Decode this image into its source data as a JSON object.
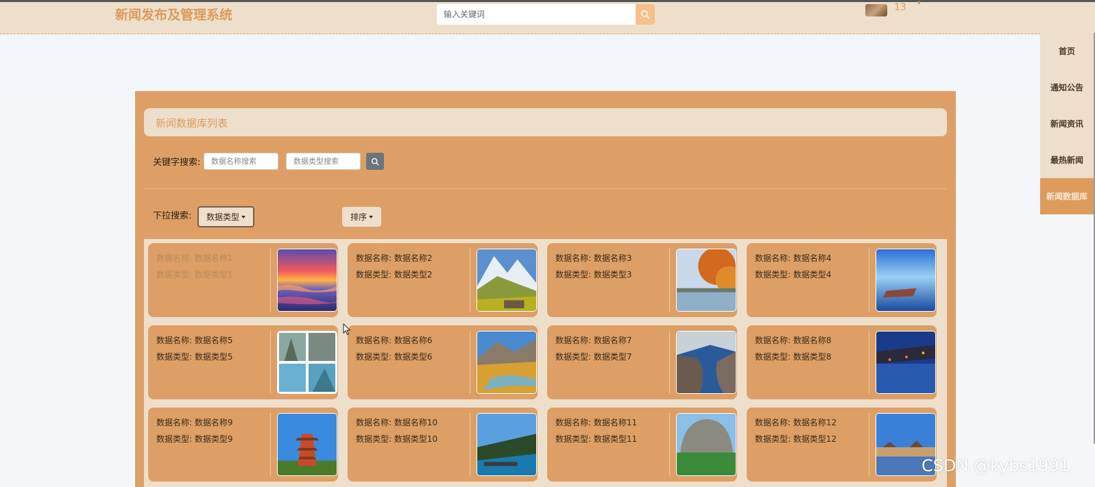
{
  "header": {
    "site_title": "新闻发布及管理系统",
    "search_placeholder": "输入关键词",
    "user_name": "13",
    "user_caret": "▾"
  },
  "sidenav": {
    "items": [
      {
        "label": "首页",
        "active": false
      },
      {
        "label": "通知公告",
        "active": false
      },
      {
        "label": "新闻资讯",
        "active": false
      },
      {
        "label": "最热新闻",
        "active": false
      },
      {
        "label": "新闻数据库",
        "active": true
      }
    ]
  },
  "panel": {
    "title": "新闻数据库列表",
    "keyword_label": "关键字搜索:",
    "name_placeholder": "数据名称搜索",
    "type_placeholder": "数据类型搜索",
    "dropdown_label": "下拉搜索:",
    "type_dropdown": "数据类型",
    "sort_dropdown": "排序"
  },
  "cards": [
    {
      "name": "数据名称: 数据名称1",
      "type": "数据类型: 数据类型1",
      "image": "sunset-terraces"
    },
    {
      "name": "数据名称: 数据名称2",
      "type": "数据类型: 数据类型2",
      "image": "mountain-village"
    },
    {
      "name": "数据名称: 数据名称3",
      "type": "数据类型: 数据类型3",
      "image": "autumn-lake"
    },
    {
      "name": "数据名称: 数据名称4",
      "type": "数据类型: 数据类型4",
      "image": "blue-lake-boat"
    },
    {
      "name": "数据名称: 数据名称5",
      "type": "数据类型: 数据类型5",
      "image": "cliff-collage"
    },
    {
      "name": "数据名称: 数据名称6",
      "type": "数据类型: 数据类型6",
      "image": "autumn-river"
    },
    {
      "name": "数据名称: 数据名称7",
      "type": "数据类型: 数据类型7",
      "image": "canyon-river"
    },
    {
      "name": "数据名称: 数据名称8",
      "type": "数据类型: 数据类型8",
      "image": "night-water-town"
    },
    {
      "name": "数据名称: 数据名称9",
      "type": "数据类型: 数据类型9",
      "image": "pagoda"
    },
    {
      "name": "数据名称: 数据名称10",
      "type": "数据类型: 数据类型10",
      "image": "resort-pool"
    },
    {
      "name": "数据名称: 数据名称11",
      "type": "数据类型: 数据类型11",
      "image": "rock-mountain"
    },
    {
      "name": "数据名称: 数据名称12",
      "type": "数据类型: 数据类型12",
      "image": "lakeside-town"
    }
  ],
  "watermark": "CSDN @kybs1991",
  "colors": {
    "accent": "#dd9b5c",
    "panel": "#dd9f65",
    "cream": "#eddfcb"
  }
}
